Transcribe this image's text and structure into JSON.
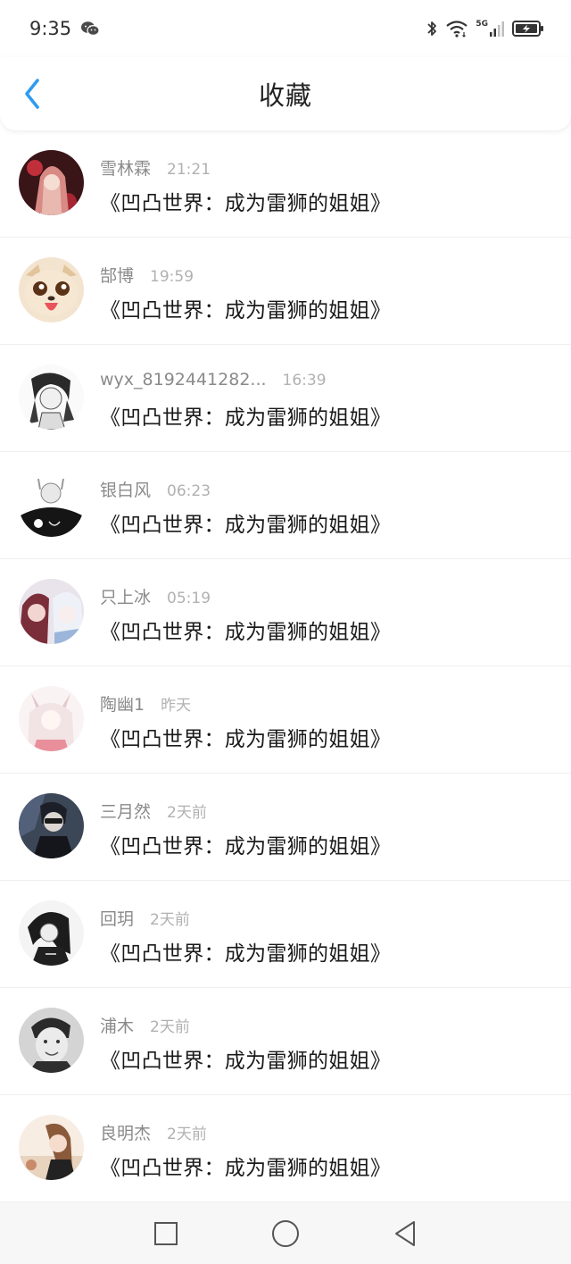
{
  "status_bar": {
    "time": "9:35",
    "network": "5G"
  },
  "header": {
    "title": "收藏"
  },
  "list": [
    {
      "username": "雪林霖",
      "time": "21:21",
      "title": "《凹凸世界：成为雷狮的姐姐》"
    },
    {
      "username": "郜博",
      "time": "19:59",
      "title": "《凹凸世界：成为雷狮的姐姐》"
    },
    {
      "username": "wyx_8192441282...",
      "time": "16:39",
      "title": "《凹凸世界：成为雷狮的姐姐》"
    },
    {
      "username": "银白风",
      "time": "06:23",
      "title": "《凹凸世界：成为雷狮的姐姐》"
    },
    {
      "username": "只上冰",
      "time": "05:19",
      "title": "《凹凸世界：成为雷狮的姐姐》"
    },
    {
      "username": "陶幽1",
      "time": "昨天",
      "title": "《凹凸世界：成为雷狮的姐姐》"
    },
    {
      "username": "三月然",
      "time": "2天前",
      "title": "《凹凸世界：成为雷狮的姐姐》"
    },
    {
      "username": "回玥",
      "time": "2天前",
      "title": "《凹凸世界：成为雷狮的姐姐》"
    },
    {
      "username": "浦木",
      "time": "2天前",
      "title": "《凹凸世界：成为雷狮的姐姐》"
    },
    {
      "username": "良明杰",
      "time": "2天前",
      "title": "《凹凸世界：成为雷狮的姐姐》"
    }
  ],
  "colors": {
    "accent": "#2f9bf0",
    "username": "#8a8a8a",
    "time": "#b1b1b1"
  },
  "icons": {
    "back": "chevron-left-icon",
    "wechat": "wechat-icon",
    "bluetooth": "bluetooth-icon",
    "wifi": "wifi-icon",
    "signal": "signal-icon",
    "battery": "battery-charging-icon",
    "nav": [
      "square-recents-icon",
      "circle-home-icon",
      "triangle-back-icon"
    ]
  }
}
